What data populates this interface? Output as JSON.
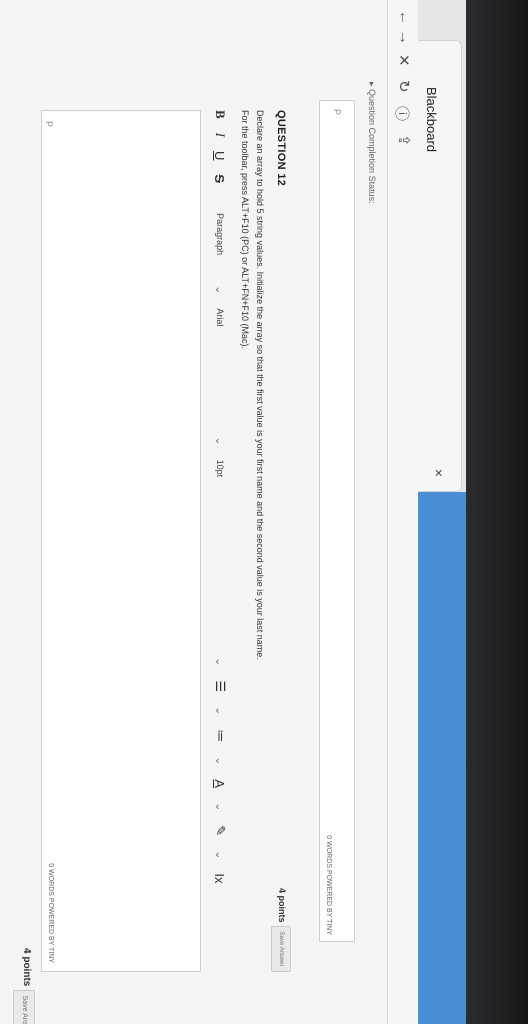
{
  "browser": {
    "tab_title": "Blackboard",
    "tab_close": "×",
    "nav": {
      "back": "←",
      "forward": "→",
      "close": "✕",
      "reload": "↻",
      "info": "ⓘ",
      "upload": "⇪"
    }
  },
  "page": {
    "status_line": "▸ Question Completion Status:",
    "prev_answer": {
      "label": "P",
      "words": "0 WORDS  POWERED BY TINY"
    }
  },
  "question": {
    "title": "QUESTION 12",
    "points": "4 points",
    "save_label": "Save Answer",
    "text": "Declare an array to hold 5 string values. Initialize the array so that the first value is your first name and the second value is your last name.",
    "toolbar_hint": "For the toolbar, press ALT+F10 (PC) or ALT+FN+F10 (Mac).",
    "toolbar": {
      "bold": "B",
      "italic": "I",
      "underline": "U",
      "strike": "S",
      "paragraph": "Paragraph",
      "font": "Arial",
      "size": "10pt",
      "ul": "☰",
      "ol": "≔",
      "font_color": "A",
      "highlight": "✎",
      "clear_format": "Ix",
      "cut": "✂",
      "copy": "⧉",
      "paste": "📋",
      "find": "🔍",
      "undo": "↶",
      "redo": "↷",
      "align_left": "≡",
      "align_center": "≡",
      "align_right": "≡",
      "justify": "≡",
      "indent": "⇥",
      "outdent": "⇤",
      "more": "•••",
      "chevron": "⌄"
    },
    "editor": {
      "path": "P",
      "words": "0 WORDS  POWERED BY TINY"
    }
  },
  "footer": {
    "points": "4 points",
    "save_label": "Save Answer"
  }
}
